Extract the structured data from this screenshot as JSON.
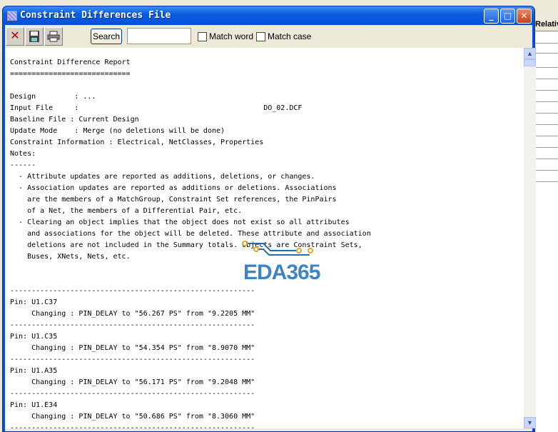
{
  "background_app": {
    "column_header": "Relative"
  },
  "window": {
    "title": "Constraint Differences File",
    "minimize": "_",
    "maximize": "□",
    "close": "✕"
  },
  "toolbar": {
    "close_icon": "✕",
    "save_icon": "save",
    "print_icon": "print",
    "search_label": "Search",
    "search_value": "",
    "match_word": "Match word",
    "match_case": "Match case"
  },
  "report_lines": [
    "Constraint Difference Report",
    "============================",
    "",
    "Design         : ...",
    "Input File     :                                           DO_02.DCF",
    "Baseline File : Current Design",
    "Update Mode    : Merge (no deletions will be done)",
    "Constraint Information : Electrical, NetClasses, Properties",
    "Notes:",
    "------",
    "  - Attribute updates are reported as additions, deletions, or changes.",
    "  - Association updates are reported as additions or deletions. Associations",
    "    are the members of a MatchGroup, Constraint Set references, the PinPairs",
    "    of a Net, the members of a Differential Pair, etc.",
    "  - Clearing an object implies that the object does not exist so all attributes",
    "    and associations for the object will be deleted. These attribute and association",
    "    deletions are not included in the Summary totals. Objects are Constraint Sets,",
    "    Buses, XNets, Nets, etc.",
    "",
    "",
    "---------------------------------------------------------",
    "Pin: U1.C37",
    "     Changing : PIN_DELAY to \"56.267 PS\" from \"9.2205 MM\"",
    "---------------------------------------------------------",
    "Pin: U1.C35",
    "     Changing : PIN_DELAY to \"54.354 PS\" from \"8.9070 MM\"",
    "---------------------------------------------------------",
    "Pin: U1.A35",
    "     Changing : PIN_DELAY to \"56.171 PS\" from \"9.2048 MM\"",
    "---------------------------------------------------------",
    "Pin: U1.E34",
    "     Changing : PIN_DELAY to \"50.686 PS\" from \"8.3060 MM\"",
    "---------------------------------------------------------"
  ],
  "watermark": "EDA365"
}
